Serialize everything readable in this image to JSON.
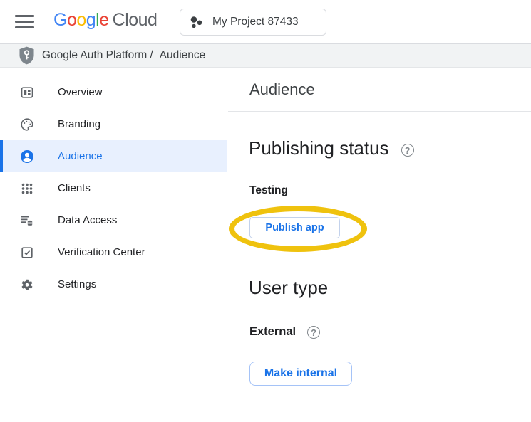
{
  "topbar": {
    "logo_letters": [
      "G",
      "o",
      "o",
      "g",
      "l",
      "e"
    ],
    "cloud_suffix": "Cloud",
    "project_selector": "My Project 87433"
  },
  "breadcrumb": {
    "product": "Google Auth Platform",
    "separator": "/",
    "page": "Audience"
  },
  "sidebar": {
    "items": [
      {
        "label": "Overview",
        "icon": "overview-icon",
        "selected": false
      },
      {
        "label": "Branding",
        "icon": "palette-icon",
        "selected": false
      },
      {
        "label": "Audience",
        "icon": "person-icon",
        "selected": true
      },
      {
        "label": "Clients",
        "icon": "apps-grid-icon",
        "selected": false
      },
      {
        "label": "Data Access",
        "icon": "list-gear-icon",
        "selected": false
      },
      {
        "label": "Verification Center",
        "icon": "checkbox-check-icon",
        "selected": false
      },
      {
        "label": "Settings",
        "icon": "gear-icon",
        "selected": false
      }
    ]
  },
  "main": {
    "page_title": "Audience",
    "publishing": {
      "heading": "Publishing status",
      "help_glyph": "?",
      "status": "Testing",
      "publish_button": "Publish app"
    },
    "user_type": {
      "heading": "User type",
      "value": "External",
      "help_glyph": "?",
      "button": "Make internal"
    },
    "annotation": "yellow-ellipse-around-publish-app"
  },
  "colors": {
    "accent_blue": "#1a73e8",
    "selected_item_bg": "#e8f0fe",
    "annotation_yellow": "#EFC20E",
    "breadcrumb_bg": "#f1f3f4",
    "border_gray": "#dadce0",
    "text_primary": "#202124",
    "text_secondary": "#5f6368",
    "logo_letter_colors": [
      "#4285F4",
      "#EA4335",
      "#FBBC05",
      "#4285F4",
      "#34A853",
      "#EA4335"
    ]
  }
}
